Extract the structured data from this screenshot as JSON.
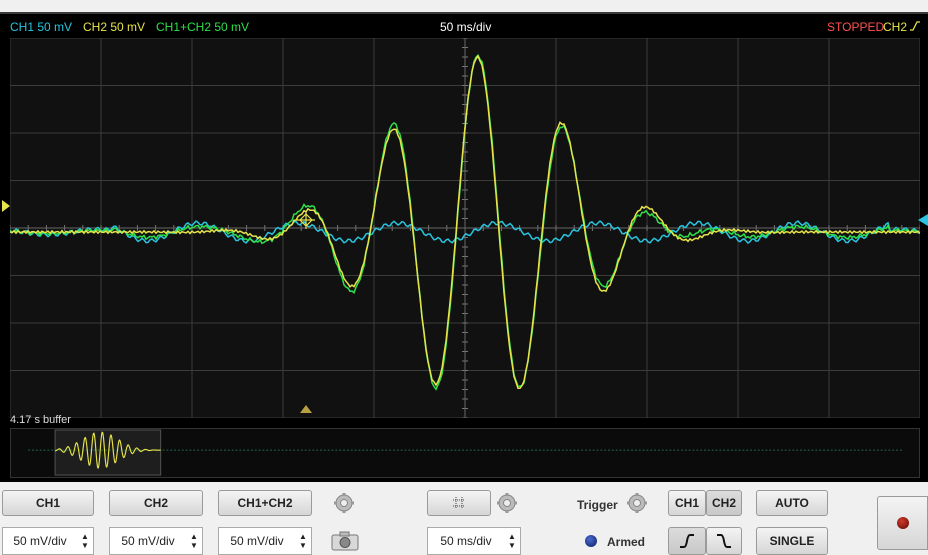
{
  "header": {
    "ch1_scale": "CH1 50 mV",
    "ch2_scale": "CH2 50 mV",
    "sum_scale": "CH1+CH2 50 mV",
    "timebase": "50 ms/div",
    "status": "STOPPED",
    "trigger_channel": "CH2",
    "trigger_slope_glyph": "⎍"
  },
  "colors": {
    "ch1": "#29c4e0",
    "ch2": "#e6e44a",
    "sum": "#2ee04a",
    "status": "#ff5050",
    "grid": "#3c3c3c"
  },
  "buffer": {
    "label": "4.17 s buffer"
  },
  "controls": {
    "ch1_button": "CH1",
    "ch2_button": "CH2",
    "sum_button": "CH1+CH2",
    "ch1_volts": "50 mV/div",
    "ch2_volts": "50 mV/div",
    "sum_volts": "50 mV/div",
    "time_div": "50 ms/div",
    "trigger_label": "Trigger",
    "armed_label": "Armed",
    "trig_ch1": "CH1",
    "trig_ch2": "CH2",
    "auto_button": "AUTO",
    "single_button": "SINGLE"
  }
}
